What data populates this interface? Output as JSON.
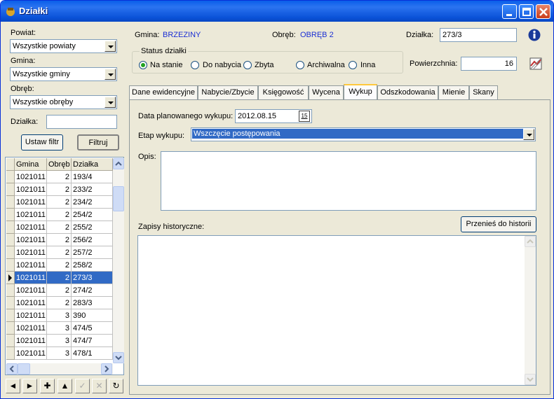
{
  "window": {
    "title": "Działki"
  },
  "filters": {
    "powiat_label": "Powiat:",
    "powiat_value": "Wszystkie powiaty",
    "gmina_label": "Gmina:",
    "gmina_value": "Wszystkie gminy",
    "obreb_label": "Obręb:",
    "obreb_value": "Wszystkie obręby",
    "dzialka_label": "Działka:",
    "dzialka_value": "",
    "set_filter_button": "Ustaw filtr",
    "filter_button": "Filtruj"
  },
  "grid": {
    "columns": [
      "Gmina",
      "Obręb",
      "Działka"
    ],
    "rows": [
      [
        "1021011",
        "2",
        "193/4"
      ],
      [
        "1021011",
        "2",
        "233/2"
      ],
      [
        "1021011",
        "2",
        "234/2"
      ],
      [
        "1021011",
        "2",
        "254/2"
      ],
      [
        "1021011",
        "2",
        "255/2"
      ],
      [
        "1021011",
        "2",
        "256/2"
      ],
      [
        "1021011",
        "2",
        "257/2"
      ],
      [
        "1021011",
        "2",
        "258/2"
      ],
      [
        "1021011",
        "2",
        "273/3"
      ],
      [
        "1021011",
        "2",
        "274/2"
      ],
      [
        "1021011",
        "2",
        "283/3"
      ],
      [
        "1021011",
        "3",
        "390"
      ],
      [
        "1021011",
        "3",
        "474/5"
      ],
      [
        "1021011",
        "3",
        "474/7"
      ],
      [
        "1021011",
        "3",
        "478/1"
      ]
    ],
    "selected_index": 8
  },
  "nav": [
    "◄",
    "►",
    "✚",
    "▲",
    "✓",
    "✕",
    "↻"
  ],
  "header": {
    "gmina_label": "Gmina:",
    "gmina_value": "BRZEZINY",
    "obreb_label": "Obręb:",
    "obreb_value": "OBRĘB 2",
    "dzialka_label": "Działka:",
    "dzialka_value": "273/3",
    "status_group_label": "Status działki",
    "statuses": [
      "Na stanie",
      "Do nabycia",
      "Zbyta",
      "Archiwalna",
      "Inna"
    ],
    "selected_status": "Na stanie",
    "powierzchnia_label": "Powierzchnia:",
    "powierzchnia_value": "16"
  },
  "tabs": [
    "Dane ewidencyjne",
    "Nabycie/Zbycie",
    "Księgowość",
    "Wycena",
    "Wykup",
    "Odszkodowania",
    "Mienie",
    "Skany"
  ],
  "active_tab": "Wykup",
  "wykup": {
    "date_label": "Data planowanego wykupu:",
    "date_value": "2012.08.15",
    "calendar_icon_text": "15",
    "etap_label": "Etap wykupu:",
    "etap_value": "Wszczęcie postępowania",
    "opis_label": "Opis:",
    "opis_value": "",
    "history_label": "Zapisy historyczne:",
    "history_button": "Przenieś do historii",
    "history_value": ""
  },
  "colors": {
    "title_bar": "#0a5fe9",
    "selection": "#316ac5",
    "link_blue": "#1a2ed4"
  }
}
